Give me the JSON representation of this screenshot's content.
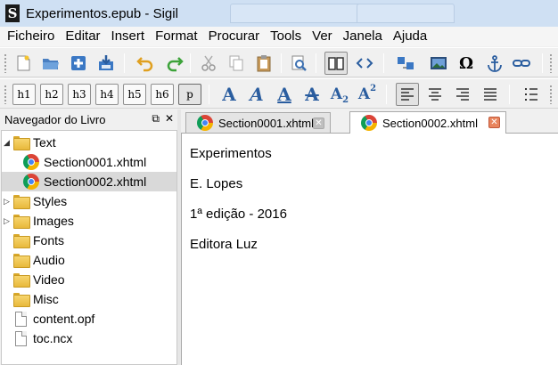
{
  "window": {
    "title": "Experimentos.epub - Sigil",
    "logo_letter": "S"
  },
  "menu": [
    "Ficheiro",
    "Editar",
    "Insert",
    "Format",
    "Procurar",
    "Tools",
    "Ver",
    "Janela",
    "Ajuda"
  ],
  "heading_buttons": [
    "h1",
    "h2",
    "h3",
    "h4",
    "h5",
    "h6",
    "p"
  ],
  "format_buttons": {
    "bold": "A",
    "italic": "A",
    "underline": "A",
    "strike": "A",
    "subscript": "A",
    "subscript_mark": "2",
    "superscript": "A",
    "superscript_mark": "2"
  },
  "toolbar_glyphs": {
    "special_chars": "Ω"
  },
  "navigator": {
    "title": "Navegador do Livro",
    "items": [
      {
        "label": "Text",
        "kind": "folder",
        "expanded": true
      },
      {
        "label": "Section0001.xhtml",
        "kind": "xhtml"
      },
      {
        "label": "Section0002.xhtml",
        "kind": "xhtml",
        "selected": true
      },
      {
        "label": "Styles",
        "kind": "folder",
        "expandable": true
      },
      {
        "label": "Images",
        "kind": "folder",
        "expandable": true
      },
      {
        "label": "Fonts",
        "kind": "folder"
      },
      {
        "label": "Audio",
        "kind": "folder"
      },
      {
        "label": "Video",
        "kind": "folder"
      },
      {
        "label": "Misc",
        "kind": "folder"
      },
      {
        "label": "content.opf",
        "kind": "file"
      },
      {
        "label": "toc.ncx",
        "kind": "file"
      }
    ]
  },
  "tabs": [
    {
      "label": "Section0001.xhtml",
      "active": false
    },
    {
      "label": "Section0002.xhtml",
      "active": true
    }
  ],
  "document": {
    "paragraphs": [
      "Experimentos",
      "E. Lopes",
      "1ª edição - 2016",
      "Editora Luz"
    ]
  },
  "colors": {
    "titlebar": "#cfe0f3",
    "format_blue": "#2a5d9f",
    "close_active": "#e9855e",
    "selection": "#d9d9d9"
  }
}
